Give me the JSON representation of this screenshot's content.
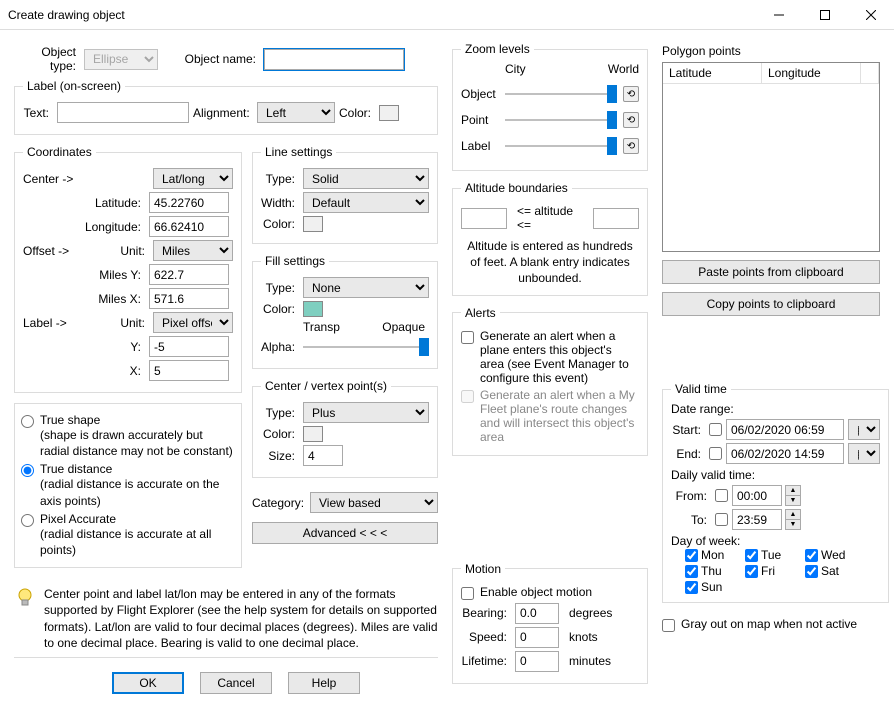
{
  "window": {
    "title": "Create drawing object"
  },
  "toprow": {
    "object_type_label": "Object type:",
    "object_type_value": "Ellipse",
    "object_name_label": "Object name:",
    "object_name_value": ""
  },
  "label_group": {
    "legend": "Label (on-screen)",
    "text_label": "Text:",
    "text_value": "",
    "alignment_label": "Alignment:",
    "alignment_value": "Left",
    "color_label": "Color:"
  },
  "coordinates": {
    "legend": "Coordinates",
    "center_arrow": "Center ->",
    "latlong_value": "Lat/long",
    "latitude_label": "Latitude:",
    "latitude_value": "45.22760",
    "longitude_label": "Longitude:",
    "longitude_value": "66.62410",
    "offset_arrow": "Offset ->",
    "unit_label": "Unit:",
    "unit_value": "Miles",
    "miles_y_label": "Miles Y:",
    "miles_y_value": "622.7",
    "miles_x_label": "Miles X:",
    "miles_x_value": "571.6",
    "label_arrow": "Label ->",
    "label_unit_value": "Pixel offset",
    "y_label": "Y:",
    "y_value": "-5",
    "x_label": "X:",
    "x_value": "5"
  },
  "shape_opts": {
    "true_shape": "True shape",
    "true_shape_desc": "(shape is drawn accurately but radial distance may not be constant)",
    "true_distance": "True distance",
    "true_distance_desc": "(radial distance is accurate on the axis points)",
    "pixel_accurate": "Pixel Accurate",
    "pixel_accurate_desc": "(radial distance is accurate at all points)"
  },
  "help_note": "Center point and label lat/lon may be entered in any of the formats supported by Flight Explorer (see the help system for details on supported formats).  Lat/lon are valid to four decimal places (degrees).  Miles are valid to one decimal place.  Bearing is valid to one decimal place.",
  "line_settings": {
    "legend": "Line settings",
    "type_label": "Type:",
    "type_value": "Solid",
    "width_label": "Width:",
    "width_value": "Default",
    "color_label": "Color:"
  },
  "fill_settings": {
    "legend": "Fill settings",
    "type_label": "Type:",
    "type_value": "None",
    "color_label": "Color:",
    "transp_label": "Transp",
    "opaque_label": "Opaque",
    "alpha_label": "Alpha:"
  },
  "center_vertex": {
    "legend": "Center / vertex point(s)",
    "type_label": "Type:",
    "type_value": "Plus",
    "color_label": "Color:",
    "size_label": "Size:",
    "size_value": "4"
  },
  "category": {
    "label": "Category:",
    "value": "View based"
  },
  "advanced_btn": "Advanced   < < <",
  "zoom": {
    "legend": "Zoom levels",
    "city": "City",
    "world": "World",
    "object": "Object",
    "point": "Point",
    "label": "Label"
  },
  "altitude": {
    "legend": "Altitude boundaries",
    "middle": "<= altitude <=",
    "low": "",
    "high": "",
    "note": "Altitude is entered as hundreds of feet. A blank entry indicates unbounded."
  },
  "alerts": {
    "legend": "Alerts",
    "a1": "Generate an alert when a plane enters this object's area (see Event Manager to configure this event)",
    "a2": "Generate an alert when a My Fleet plane's route changes and will intersect this object's area"
  },
  "motion": {
    "legend": "Motion",
    "enable": "Enable object motion",
    "bearing_label": "Bearing:",
    "bearing_value": "0.0",
    "bearing_unit": "degrees",
    "speed_label": "Speed:",
    "speed_value": "0",
    "speed_unit": "knots",
    "lifetime_label": "Lifetime:",
    "lifetime_value": "0",
    "lifetime_unit": "minutes"
  },
  "polygon": {
    "legend": "Polygon points",
    "col1": "Latitude",
    "col2": "Longitude",
    "paste_btn": "Paste points from clipboard",
    "copy_btn": "Copy points to clipboard"
  },
  "valid_time": {
    "legend": "Valid time",
    "date_range": "Date range:",
    "start_label": "Start:",
    "start_value": "06/02/2020 06:59",
    "end_label": "End:",
    "end_value": "06/02/2020 14:59",
    "daily": "Daily valid time:",
    "from_label": "From:",
    "from_value": "00:00",
    "to_label": "To:",
    "to_value": "23:59",
    "dow_label": "Day of week:",
    "mon": "Mon",
    "tue": "Tue",
    "wed": "Wed",
    "thu": "Thu",
    "fri": "Fri",
    "sat": "Sat",
    "sun": "Sun",
    "gray_out": "Gray out on map when not active"
  },
  "buttons": {
    "ok": "OK",
    "cancel": "Cancel",
    "help": "Help"
  }
}
